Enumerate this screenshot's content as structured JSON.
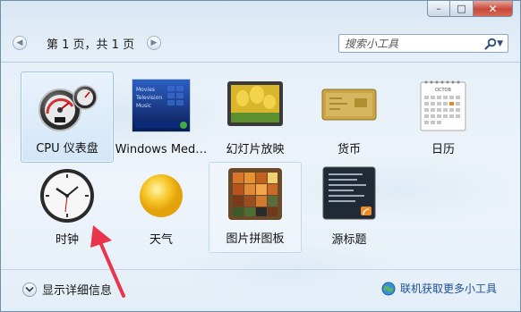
{
  "window": {
    "close_glyph": "✕",
    "max_glyph": "□",
    "min_glyph": "–"
  },
  "toolbar": {
    "page_label": "第 1 页，共 1 页",
    "prev_glyph": "◀",
    "next_glyph": "▶",
    "search_placeholder": "搜索小工具"
  },
  "gadgets": [
    {
      "label": "CPU 仪表盘",
      "icon": "cpu-meter-icon"
    },
    {
      "label": "Windows Med…",
      "icon": "windows-media-center-icon"
    },
    {
      "label": "幻灯片放映",
      "icon": "slideshow-icon"
    },
    {
      "label": "货币",
      "icon": "currency-icon"
    },
    {
      "label": "日历",
      "icon": "calendar-icon",
      "month": "OCTOB"
    },
    {
      "label": "时钟",
      "icon": "clock-icon"
    },
    {
      "label": "天气",
      "icon": "weather-icon"
    },
    {
      "label": "图片拼图板",
      "icon": "picture-puzzle-icon"
    },
    {
      "label": "源标题",
      "icon": "feed-headlines-icon"
    }
  ],
  "media_center_lines": [
    "Movies",
    "Television",
    "Music"
  ],
  "footer": {
    "details_label": "显示详细信息",
    "online_label": "联机获取更多小工具"
  },
  "colors": {
    "accent": "#1c4f97",
    "annotation_arrow": "#e8344c",
    "close_button": "#c8483a"
  }
}
